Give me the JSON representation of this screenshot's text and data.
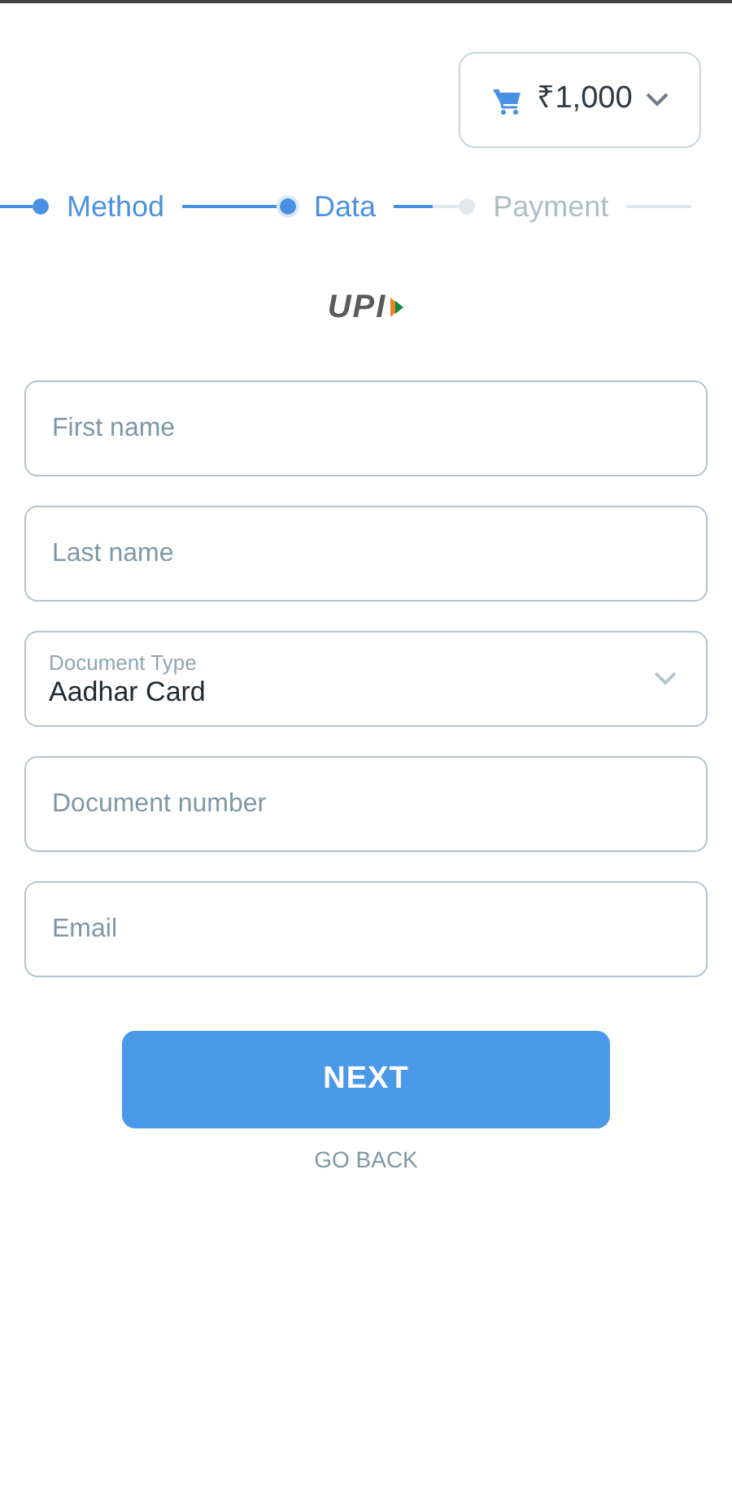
{
  "cart": {
    "amount": "₹1,000"
  },
  "steps": [
    {
      "label": "Method",
      "done": true,
      "selected": false
    },
    {
      "label": "Data",
      "done": false,
      "selected": true
    },
    {
      "label": "Payment",
      "done": false,
      "selected": false
    }
  ],
  "logo": {
    "text": "UPI"
  },
  "fields": [
    {
      "kind": "input",
      "placeholder": "First name"
    },
    {
      "kind": "input",
      "placeholder": "Last name"
    },
    {
      "kind": "select",
      "label": "Document Type",
      "value": "Aadhar Card"
    },
    {
      "kind": "input",
      "placeholder": "Document number"
    },
    {
      "kind": "input",
      "placeholder": "Email"
    }
  ],
  "next_button": "NEXT",
  "back_link": "GO BACK"
}
